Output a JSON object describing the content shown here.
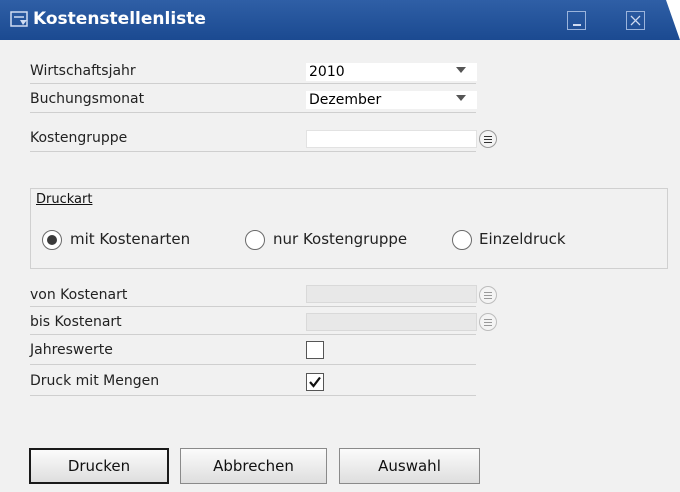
{
  "window": {
    "title": "Kostenstellenliste",
    "icons": [
      "document-icon",
      "minimize-icon",
      "close-icon"
    ]
  },
  "form": {
    "wirtschaftsjahr": {
      "label": "Wirtschaftsjahr",
      "value": "2010"
    },
    "buchungsmonat": {
      "label": "Buchungsmonat",
      "value": "Dezember"
    },
    "kostengruppe": {
      "label": "Kostengruppe",
      "value": ""
    },
    "druckart": {
      "title": "Druckart",
      "options": [
        {
          "label": "mit Kostenarten",
          "checked": true
        },
        {
          "label": "nur Kostengruppe",
          "checked": false
        },
        {
          "label": "Einzeldruck",
          "checked": false
        }
      ]
    },
    "von_kostenart": {
      "label": "von Kostenart",
      "value": ""
    },
    "bis_kostenart": {
      "label": "bis Kostenart",
      "value": ""
    },
    "jahreswerte": {
      "label": "Jahreswerte",
      "checked": false
    },
    "druck_mit_mengen": {
      "label": "Druck mit Mengen",
      "checked": true
    }
  },
  "buttons": {
    "drucken": "Drucken",
    "abbrechen": "Abbrechen",
    "auswahl": "Auswahl"
  }
}
